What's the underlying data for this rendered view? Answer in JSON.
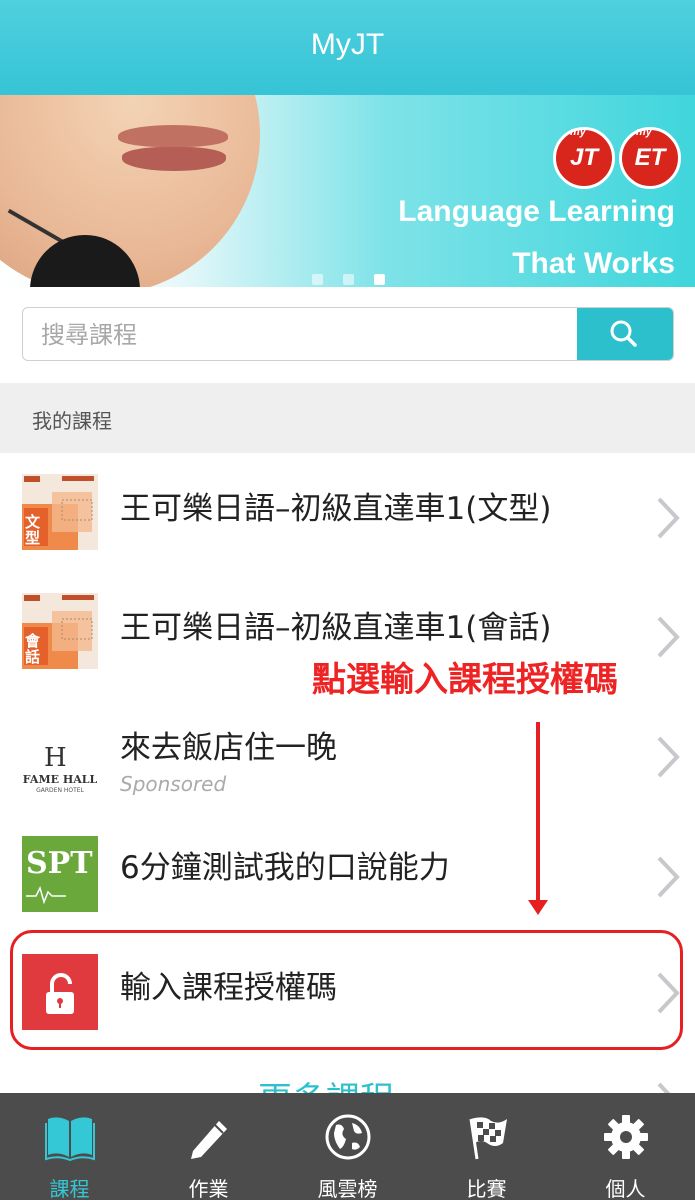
{
  "header": {
    "title": "MyJT"
  },
  "banner": {
    "logo_jt": "JT",
    "logo_et": "ET",
    "logo_prefix": "my",
    "line1": "Language Learning",
    "line2": "That Works",
    "dots": 3,
    "active_dot": 2
  },
  "search": {
    "placeholder": "搜尋課程"
  },
  "section": {
    "title": "我的課程"
  },
  "courses": [
    {
      "title": "王可樂日語–初級直達車1(文型)",
      "thumb_label": "文型",
      "thumb_color": "#f08a4b"
    },
    {
      "title": "王可樂日語–初級直達車1(會話)",
      "thumb_label": "會話",
      "thumb_color": "#f08a4b"
    },
    {
      "title": "來去飯店住一晚",
      "subtitle": "Sponsored",
      "thumb_brand": "FAME HALL",
      "thumb_sub": "GARDEN HOTEL"
    },
    {
      "title": "6分鐘測試我的口說能力",
      "thumb_brand": "SPT",
      "thumb_color": "#6aa83c"
    },
    {
      "title": "輸入課程授權碼",
      "thumb_color": "#e03a3e"
    }
  ],
  "annotation": {
    "text": "點選輸入課程授權碼",
    "color": "#e62020"
  },
  "more": {
    "label": "更多課程"
  },
  "tabs": [
    {
      "label": "課程",
      "icon": "book-icon",
      "active": true
    },
    {
      "label": "作業",
      "icon": "pencil-icon",
      "active": false
    },
    {
      "label": "風雲榜",
      "icon": "globe-icon",
      "active": false
    },
    {
      "label": "比賽",
      "icon": "checkered-flag-icon",
      "active": false
    },
    {
      "label": "個人",
      "icon": "gear-icon",
      "active": false
    }
  ],
  "colors": {
    "accent": "#2cc0cd",
    "header": "#40c8d8",
    "annotation": "#e62020",
    "tabbar": "#4c4c4c"
  }
}
